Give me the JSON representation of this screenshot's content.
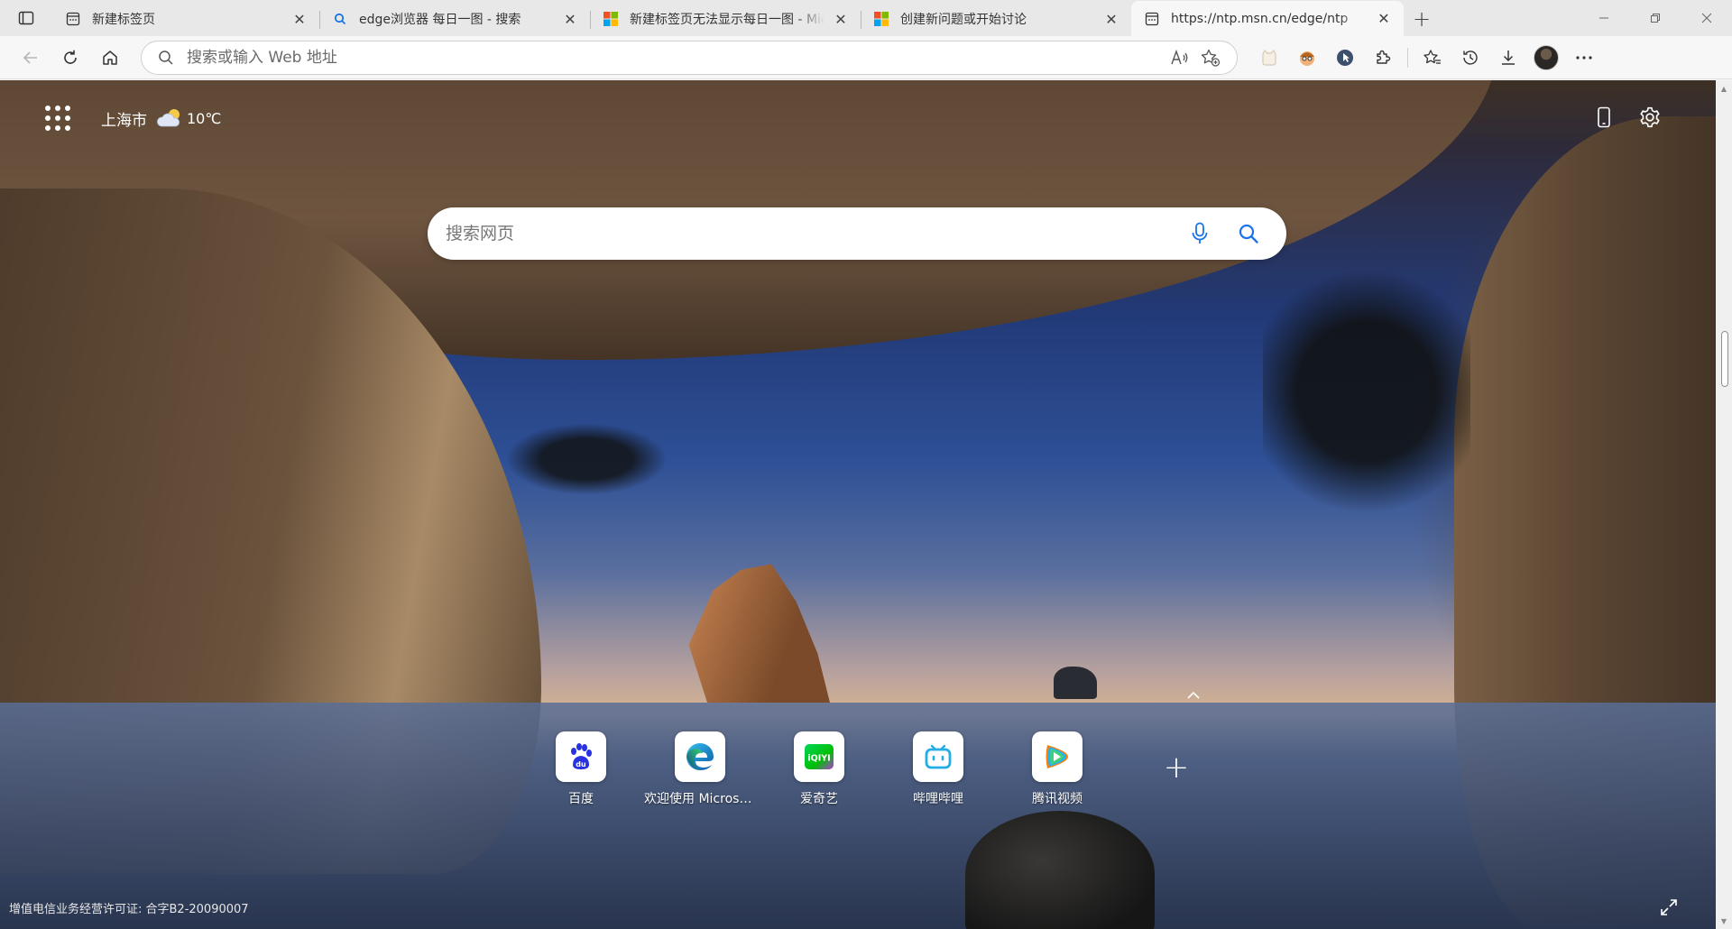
{
  "tabs": [
    {
      "title": "新建标签页",
      "favicon": "newtab-icon",
      "active": false
    },
    {
      "title": "edge浏览器 每日一图 - 搜索",
      "favicon": "search-icon",
      "active": false
    },
    {
      "title": "新建标签页无法显示每日一图 - Microsoft",
      "favicon": "microsoft-logo-icon",
      "active": false
    },
    {
      "title": "创建新问题或开始讨论",
      "favicon": "microsoft-logo-icon",
      "active": false
    },
    {
      "title": "https://ntp.msn.cn/edge/ntp",
      "favicon": "newtab-icon",
      "active": true
    }
  ],
  "toolbar": {
    "address_placeholder": "搜索或输入 Web 地址"
  },
  "page": {
    "weather": {
      "city": "上海市",
      "temperature": "10℃",
      "icon": "partly-cloudy-icon"
    },
    "search_placeholder": "搜索网页",
    "quick_links": [
      {
        "label": "百度",
        "icon": "baidu-logo-icon"
      },
      {
        "label": "欢迎使用 Microsoft Edge",
        "icon": "edge-logo-icon"
      },
      {
        "label": "爱奇艺",
        "icon": "iqiyi-logo-icon"
      },
      {
        "label": "哔哩哔哩",
        "icon": "bilibili-logo-icon"
      },
      {
        "label": "腾讯视频",
        "icon": "tencent-video-logo-icon"
      }
    ],
    "footer_license": "增值电信业务经营许可证: 合字B2-20090007"
  },
  "colors": {
    "accent": "#1a73e8",
    "baidu_blue": "#2932e1",
    "bilibili_blue": "#23ade5",
    "iqiyi_green": "#00be06"
  }
}
